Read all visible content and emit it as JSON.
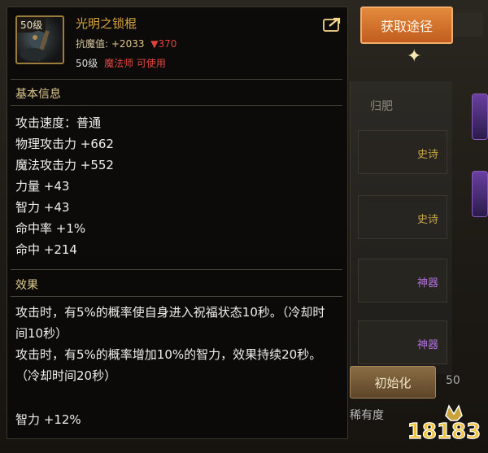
{
  "item": {
    "level_badge": "50级",
    "name": "光明之锁棍",
    "resist_label": "抗魔值:",
    "resist_value": "+2033",
    "resist_diff": "▼370",
    "req_level": "50级",
    "req_class": "魔法师 可使用"
  },
  "get_button": "获取途径",
  "basic": {
    "title": "基本信息",
    "stats": [
      "攻击速度：普通",
      "物理攻击力 +662",
      "魔法攻击力 +552",
      "力量 +43",
      "智力 +43",
      "命中率 +1%",
      "命中 +214"
    ]
  },
  "effect": {
    "title": "效果",
    "lines": [
      "攻击时，有5%的概率使自身进入祝福状态10秒。（冷却时间10秒）",
      "攻击时，有5%的概率增加10%的智力，效果持续20秒。（冷却时间20秒）"
    ],
    "bonus": "智力 +12%"
  },
  "background": {
    "tab": "归肥",
    "rows": [
      "史诗",
      "史诗",
      "神器",
      "神器"
    ],
    "button": "初始化",
    "label": "稀有度",
    "number": "50"
  },
  "watermark": "18183",
  "colors": {
    "item_name": "#d6a43c",
    "class_req": "#e2463f",
    "button": "#d2702a"
  }
}
